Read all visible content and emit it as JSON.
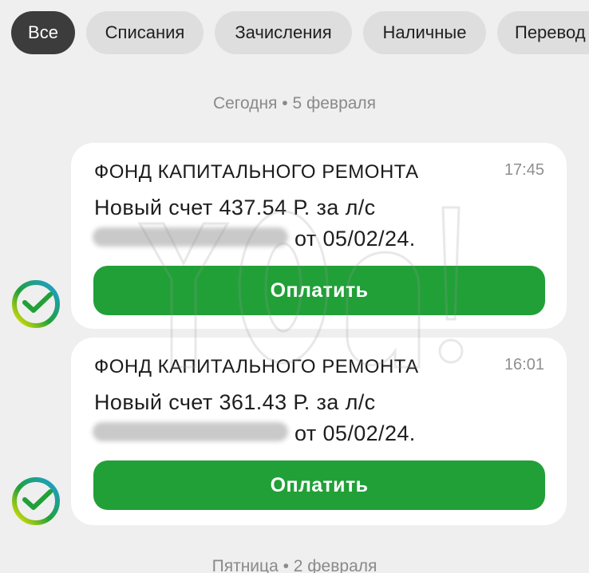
{
  "filters": {
    "all": "Все",
    "debits": "Списания",
    "credits": "Зачисления",
    "cash": "Наличные",
    "transfers": "Перевод"
  },
  "dates": {
    "today": "Сегодня • 5 февраля",
    "friday": "Пятница • 2 февраля"
  },
  "messages": [
    {
      "title": "ФОНД КАПИТАЛЬНОГО РЕМОНТА",
      "time": "17:45",
      "line1": "Новый счет 437.54 Р. за л/с",
      "line2": "от 05/02/24.",
      "button": "Оплатить"
    },
    {
      "title": "ФОНД КАПИТАЛЬНОГО РЕМОНТА",
      "time": "16:01",
      "line1": "Новый счет 361.43 Р. за л/с",
      "line2": "от 05/02/24.",
      "button": "Оплатить"
    }
  ],
  "colors": {
    "accent_green": "#21a038",
    "active_chip": "#3c3c3c",
    "chip": "#dedede",
    "background": "#efefef"
  },
  "icons": {
    "sender_avatar": "sber-logo-icon"
  }
}
